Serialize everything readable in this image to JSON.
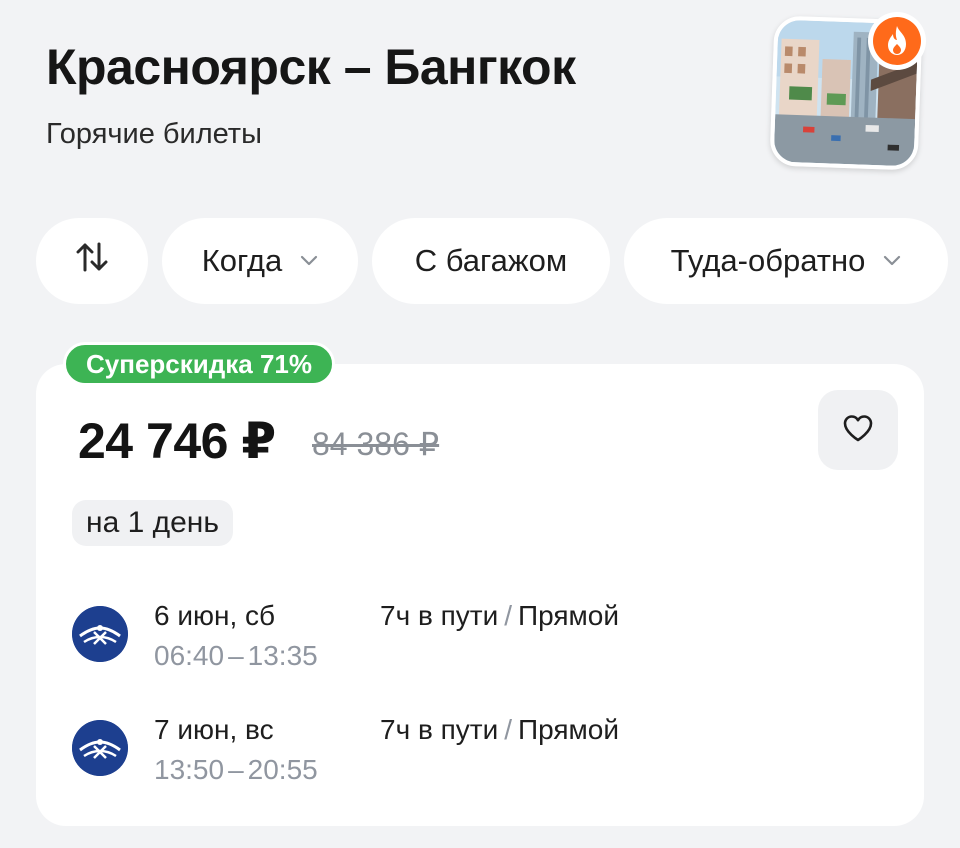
{
  "header": {
    "title": "Красноярск – Бангкок",
    "subtitle": "Горячие билеты",
    "thumbnail_icon": "city-photo",
    "badge_icon": "fire-icon"
  },
  "filters": {
    "sort_icon": "sort-arrows-icon",
    "when": "Когда",
    "baggage": "С багажом",
    "trip_type": "Туда-обратно"
  },
  "offer": {
    "promo": "Суперскидка 71%",
    "price": "24 746 ₽",
    "old_price": "84 386 ₽",
    "duration": "на 1 день",
    "favorite_icon": "heart-icon",
    "legs": [
      {
        "date": "6 июн, сб",
        "depart": "06:40",
        "dash": "–",
        "arrive": "13:35",
        "travel_time": "7ч в пути",
        "sep": "/",
        "type": "Прямой",
        "airline_icon": "aeroflot-logo"
      },
      {
        "date": "7 июн, вс",
        "depart": "13:50",
        "dash": "–",
        "arrive": "20:55",
        "travel_time": "7ч в пути",
        "sep": "/",
        "type": "Прямой",
        "airline_icon": "aeroflot-logo"
      }
    ]
  },
  "colors": {
    "background": "#f2f3f5",
    "promo_green": "#3db454",
    "fire_orange": "#ff6a1a",
    "airline_blue": "#1d3f8f",
    "muted_text": "#9096a0"
  }
}
